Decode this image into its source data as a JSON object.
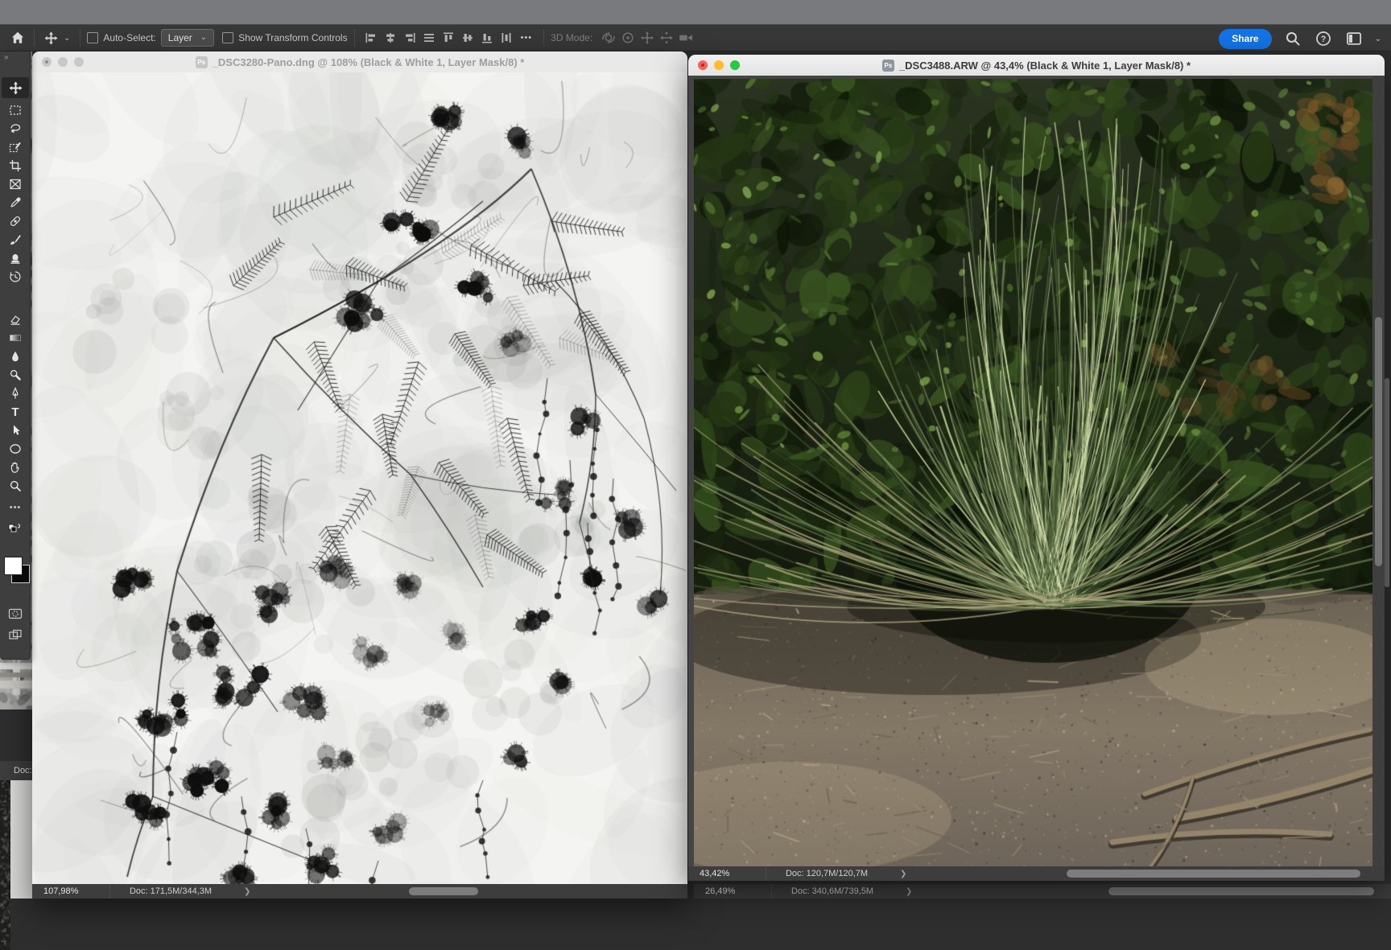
{
  "options_bar": {
    "auto_select_label": "Auto-Select:",
    "auto_select_value": "Layer",
    "show_transform_label": "Show Transform Controls",
    "mode_3d_label": "3D Mode:",
    "share_label": "Share"
  },
  "windows": {
    "left": {
      "title": "_DSC3280-Pano.dng @ 108% (Black & White 1, Layer Mask/8) *",
      "zoom_level": "107,98%",
      "doc_info": "Doc: 171,5M/344,3M"
    },
    "right": {
      "title": "_DSC3488.ARW @ 43,4% (Black & White 1, Layer Mask/8) *",
      "zoom_level": "43,42%",
      "doc_info": "Doc: 120,7M/120,7M"
    },
    "behind_right": {
      "zoom_level": "26,49%",
      "doc_info": "Doc: 340,6M/739,5M"
    },
    "behind_left": {
      "doc_info": "Doc:"
    }
  },
  "icons": {
    "double_chevron": "»",
    "caret_down": "⌄",
    "ellipsis": "•••",
    "chevron_right": "❯",
    "question_mark": "?",
    "ps_badge": "Ps",
    "type_tool_glyph": "T"
  },
  "colors": {
    "accent_blue": "#1473e6",
    "traffic_close": "#ff5f57",
    "traffic_minimize": "#febc2e",
    "traffic_zoom": "#28c840",
    "options_bar_bg": "#383838",
    "status_bar_bg": "#3d3d3d",
    "title_bar_active_bg": "#ececec",
    "canvas_area_bg": "#454545"
  }
}
